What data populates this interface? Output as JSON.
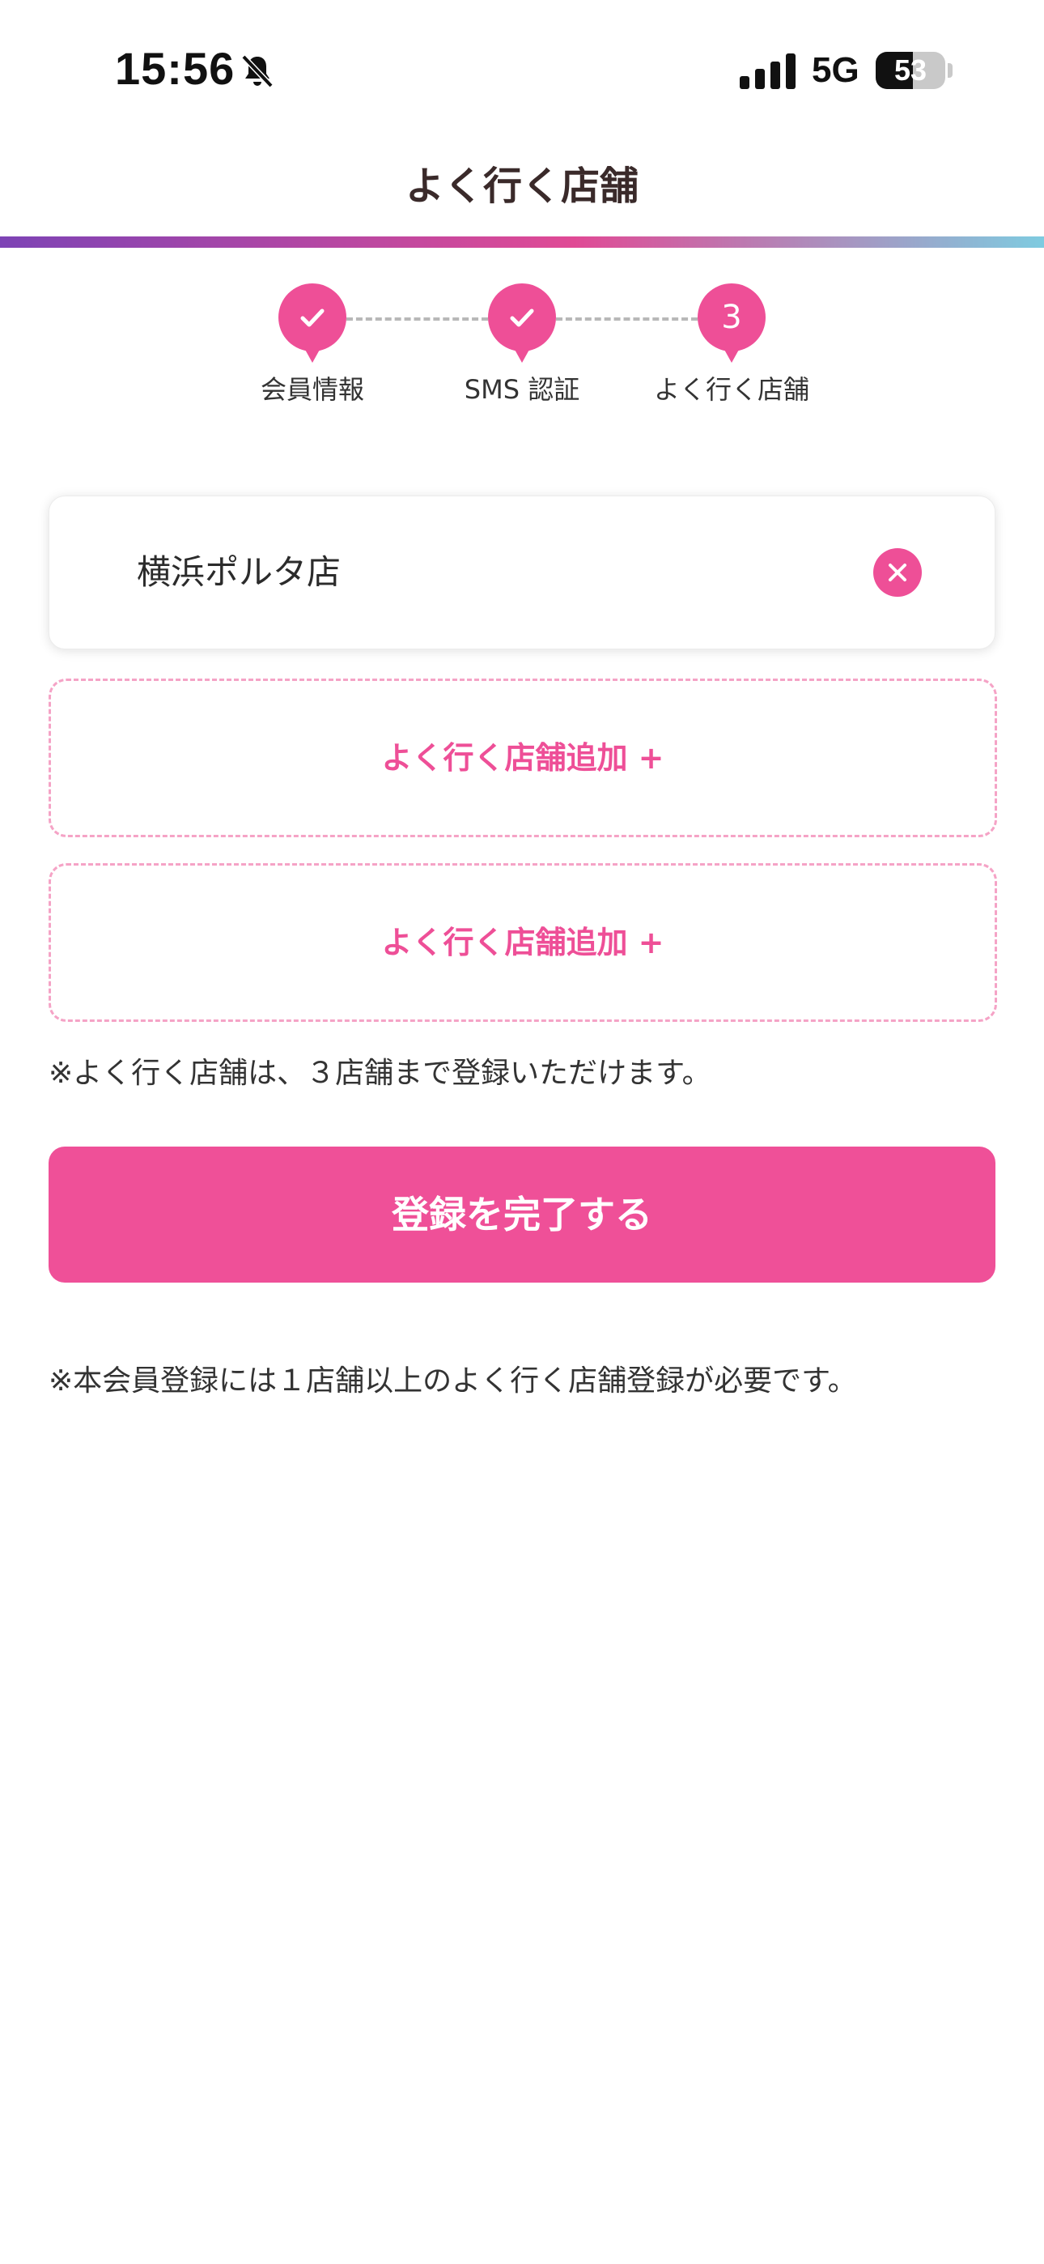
{
  "status_bar": {
    "time": "15:56",
    "network": "5G",
    "battery": "53",
    "battery_level": 0.53,
    "icons": [
      "bell-muted-icon",
      "cellular-signal-icon",
      "battery-icon"
    ]
  },
  "header": {
    "title": "よく行く店舗",
    "gradient_colors": [
      "#7d43b5",
      "#e04a95",
      "#7ecbe0"
    ]
  },
  "stepper": {
    "steps": [
      {
        "label": "会員情報",
        "state": "done",
        "icon": "check-icon"
      },
      {
        "label": "SMS 認証",
        "state": "done",
        "icon": "check-icon"
      },
      {
        "label": "よく行く店舗",
        "state": "current",
        "number": "3"
      }
    ],
    "accent": "#ee4f97"
  },
  "stores": {
    "selected": [
      {
        "name": "横浜ポルタ店",
        "remove_icon": "close-icon"
      }
    ],
    "add_slots": [
      {
        "label": "よく行く店舗追加 +"
      },
      {
        "label": "よく行く店舗追加 +"
      }
    ],
    "limit_note": "※よく行く店舗は、３店舗まで登録いただけます。"
  },
  "actions": {
    "submit_label": "登録を完了する",
    "submit_color": "#ef5098"
  },
  "footer": {
    "note": "※本会員登録には１店舗以上のよく行く店舗登録が必要です。"
  }
}
